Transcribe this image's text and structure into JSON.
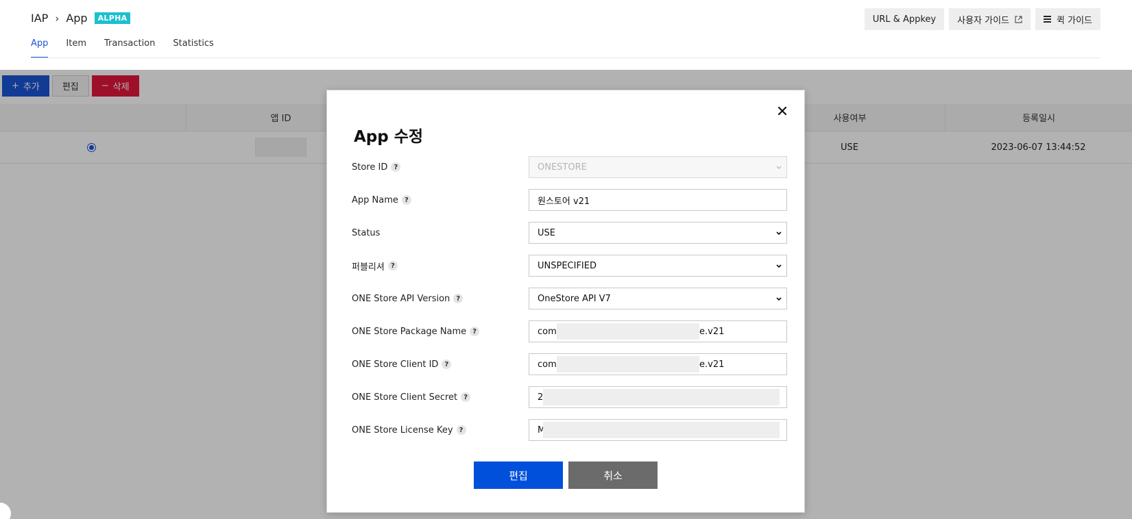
{
  "breadcrumb": {
    "root": "IAP",
    "current": "App",
    "badge": "ALPHA"
  },
  "top_actions": {
    "url_appkey": "URL & Appkey",
    "user_guide": "사용자 가이드",
    "quick_guide": "퀵 가이드"
  },
  "tabs": [
    {
      "label": "App",
      "active": true
    },
    {
      "label": "Item",
      "active": false
    },
    {
      "label": "Transaction",
      "active": false
    },
    {
      "label": "Statistics",
      "active": false
    }
  ],
  "toolbar": {
    "add": "추가",
    "edit": "편집",
    "delete": "삭제"
  },
  "grid": {
    "headers": {
      "app_id": "앱 ID",
      "use_yn": "사용여부",
      "reg_date": "등록일시"
    },
    "rows": [
      {
        "selected": true,
        "use_yn": "USE",
        "reg_date": "2023-06-07 13:44:52"
      }
    ]
  },
  "modal": {
    "title": "App 수정",
    "fields": {
      "store_id": {
        "label": "Store ID",
        "value": "ONESTORE"
      },
      "app_name": {
        "label": "App Name",
        "value": "원스토어 v21"
      },
      "status": {
        "label": "Status",
        "value": "USE"
      },
      "publisher": {
        "label": "퍼블리셔",
        "value": "UNSPECIFIED"
      },
      "api_version": {
        "label": "ONE Store API Version",
        "value": "OneStore API V7"
      },
      "package_name": {
        "label": "ONE Store Package Name",
        "prefix": "com.",
        "suffix": "e.v21"
      },
      "client_id": {
        "label": "ONE Store Client ID",
        "prefix": "com.",
        "suffix": "e.v21"
      },
      "client_secret": {
        "label": "ONE Store Client Secret",
        "prefix": "2"
      },
      "license_key": {
        "label": "ONE Store License Key",
        "prefix": "M"
      }
    },
    "buttons": {
      "submit": "편집",
      "cancel": "취소"
    }
  }
}
